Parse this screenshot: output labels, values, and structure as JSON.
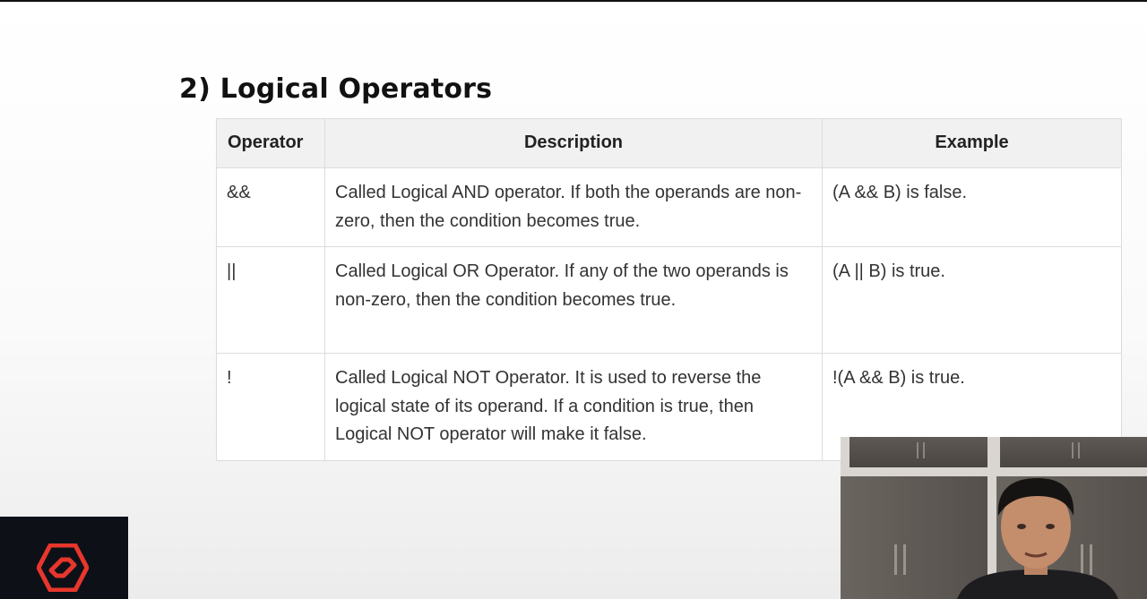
{
  "slide": {
    "title": "2) Logical Operators"
  },
  "table": {
    "headers": {
      "operator": "Operator",
      "description": "Description",
      "example": "Example"
    },
    "rows": [
      {
        "operator": "&&",
        "description": "Called Logical AND operator. If both the operands are non-zero, then the condition becomes true.",
        "example": "(A && B) is false."
      },
      {
        "operator": "||",
        "description": "Called Logical OR Operator. If any of the two operands is non-zero, then the condition becomes true.",
        "example": "(A || B) is true."
      },
      {
        "operator": "!",
        "description": "Called Logical NOT Operator. It is used to reverse the logical state of its operand. If a condition is true, then Logical NOT operator will make it false.",
        "example": "!(A && B) is true."
      }
    ]
  },
  "branding": {
    "logo_icon": "hexagon-s-logo-icon",
    "logo_color": "#e8362d"
  }
}
